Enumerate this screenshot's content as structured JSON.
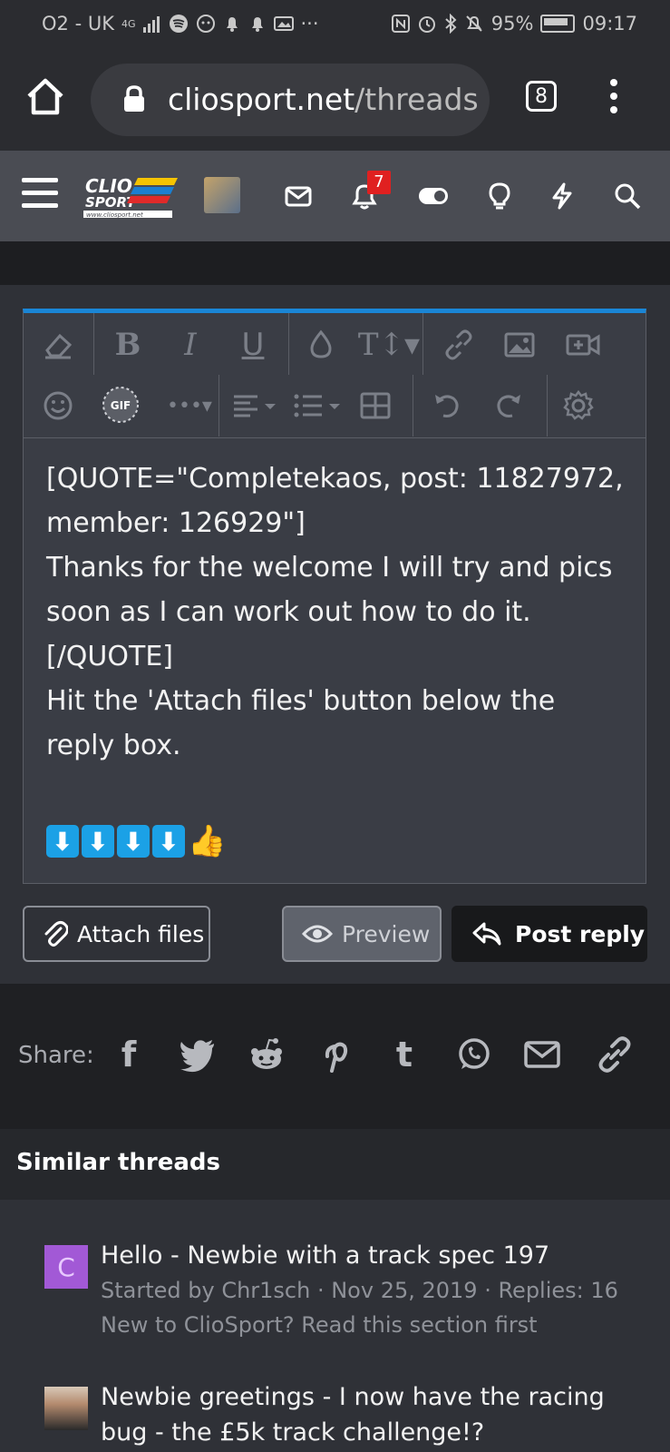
{
  "status_bar": {
    "carrier": "O2 - UK",
    "network": "4G",
    "battery": "95%",
    "time": "09:17",
    "more": "···"
  },
  "browser": {
    "url_domain": "cliosport.net",
    "url_path": "/threads",
    "tab_count": "8"
  },
  "site_nav": {
    "logo_line1": "CLIO",
    "logo_line2": "SPORT",
    "logo_url": "www.cliosport.net",
    "alerts_count": "7"
  },
  "editor": {
    "content": "[QUOTE=\"Completekaos, post: 11827972, member: 126929\"]\nThanks for the welcome I will try and pics soon as I can work out how to do it.\n[/QUOTE]\nHit the 'Attach files' button below the reply box.",
    "emoji": [
      "⬇",
      "⬇",
      "⬇",
      "⬇"
    ],
    "thumb": "👍",
    "gif_label": "GIF"
  },
  "actions": {
    "attach_label": "Attach files",
    "preview_label": "Preview",
    "post_label": "Post reply"
  },
  "share": {
    "label": "Share:"
  },
  "similar": {
    "title": "Similar threads",
    "threads": [
      {
        "avatar_letter": "C",
        "title": "Hello - Newbie with a track spec 197",
        "meta": "Started by Chr1sch · Nov 25, 2019 · Replies: 16",
        "forum": "New to ClioSport? Read this section first"
      },
      {
        "title": "Newbie greetings - I now have the racing bug - the £5k track challenge!?"
      }
    ]
  }
}
